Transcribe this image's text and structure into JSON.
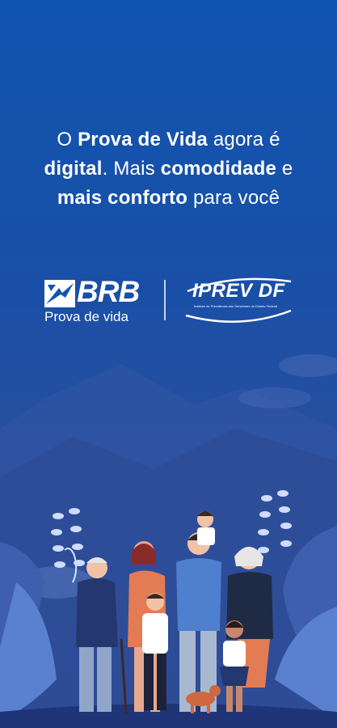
{
  "headline": {
    "line1_pre": "O ",
    "line1_bold": "Prova de Vida",
    "line1_post": " agora é",
    "line2_bold": "digital",
    "line2_mid": ". Mais ",
    "line2_bold2": "comodidade",
    "line2_post": " e",
    "line3_bold": "mais conforto",
    "line3_post": " para você"
  },
  "logos": {
    "brb_name": "BRB",
    "brb_sub": "Prova de vida",
    "iprev_name": "IPREV DF",
    "iprev_sub": "Instituto de Previdência dos Servidores do Distrito Federal"
  },
  "colors": {
    "bg_top": "#0f55b0",
    "bg_bottom": "#2a3f86",
    "text": "#ffffff"
  }
}
